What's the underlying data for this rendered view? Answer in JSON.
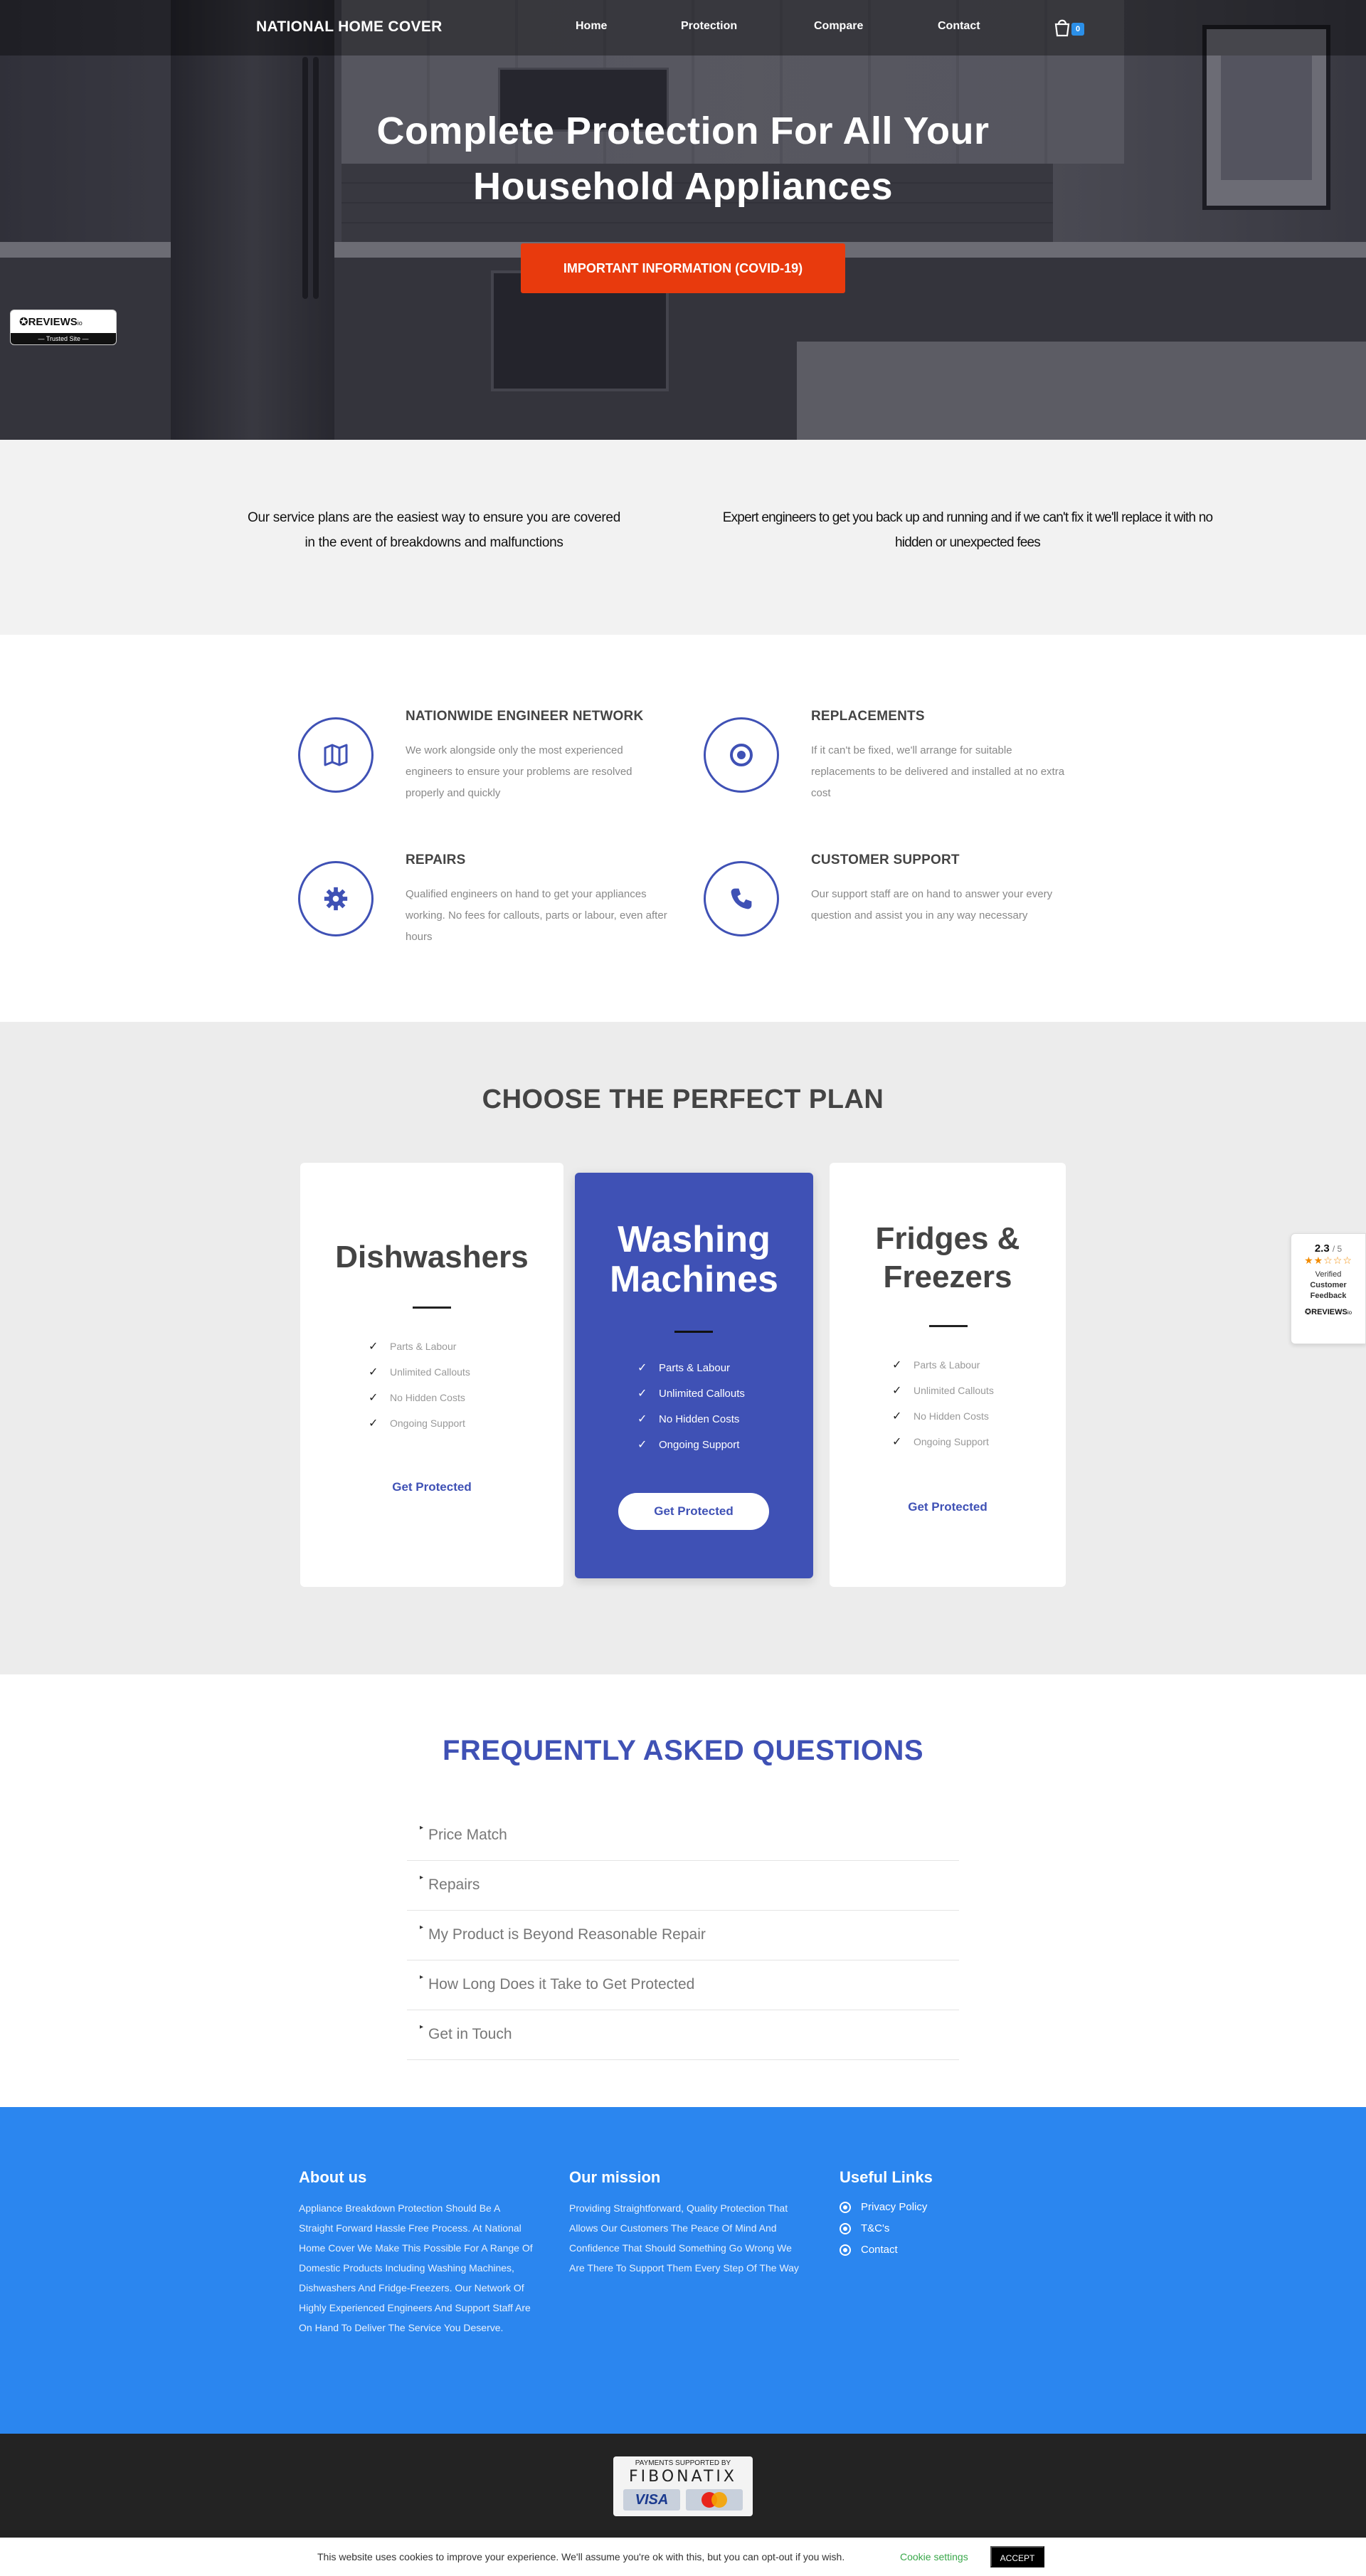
{
  "header": {
    "brand": "NATIONAL HOME COVER",
    "nav": [
      "Home",
      "Protection",
      "Compare",
      "Contact"
    ],
    "cart_count": "0"
  },
  "hero": {
    "title_line1": "Complete Protection For All Your",
    "title_line2": "Household Appliances",
    "button": "IMPORTANT INFORMATION (COVID-19)"
  },
  "reviews_badge": {
    "logo": "REVIEWS",
    "logo_suffix": "io",
    "trusted": "— Trusted Site —"
  },
  "intro": {
    "left_line1": "Our service plans are the easiest way to ensure you are covered",
    "left_line2": "in the event of breakdowns and malfunctions",
    "right_line1": "Expert engineers to get you back up and running and if we can't fix it we'll replace it with no",
    "right_line2": "hidden or unexpected fees"
  },
  "features": [
    {
      "icon": "map-icon",
      "title": "NATIONWIDE ENGINEER NETWORK",
      "desc": "We work alongside only the most experienced engineers to ensure your problems are resolved properly and quickly"
    },
    {
      "icon": "target-icon",
      "title": "REPLACEMENTS",
      "desc": "If it can't be fixed, we'll arrange for suitable replacements to be delivered and installed at no extra cost"
    },
    {
      "icon": "gear-icon",
      "title": "REPAIRS",
      "desc": "Qualified engineers on hand to get your appliances working. No fees for callouts, parts or labour, even after hours"
    },
    {
      "icon": "phone-icon",
      "title": "CUSTOMER SUPPORT",
      "desc": "Our support staff are on hand to answer your every question and assist you in any way necessary"
    }
  ],
  "plans": {
    "title": "CHOOSE THE PERFECT PLAN",
    "cards": [
      {
        "title_line1": "Dishwashers",
        "title_line2": "",
        "features": [
          "Parts & Labour",
          "Unlimited Callouts",
          "No Hidden Costs",
          "Ongoing Support"
        ],
        "cta": "Get Protected"
      },
      {
        "title_line1": "Washing",
        "title_line2": "Machines",
        "features": [
          "Parts & Labour",
          "Unlimited Callouts",
          "No Hidden Costs",
          "Ongoing Support"
        ],
        "cta": "Get Protected"
      },
      {
        "title_line1": "Fridges &",
        "title_line2": "Freezers",
        "features": [
          "Parts & Labour",
          "Unlimited Callouts",
          "No Hidden Costs",
          "Ongoing Support"
        ],
        "cta": "Get Protected"
      }
    ]
  },
  "feedback_widget": {
    "score": "2.3",
    "out_of": "/ 5",
    "stars": "★★☆☆☆",
    "line1": "Verified",
    "line2": "Customer",
    "line3": "Feedback",
    "logo": "REVIEWS",
    "logo_suffix": "io"
  },
  "faq": {
    "title": "FREQUENTLY ASKED QUESTIONS",
    "items": [
      "Price Match",
      "Repairs",
      "My Product is Beyond Reasonable Repair",
      "How Long Does it Take to Get Protected",
      "Get in Touch"
    ]
  },
  "footer": {
    "about_heading": "About us",
    "about_text": "Appliance Breakdown Protection Should Be A Straight Forward Hassle Free Process. At National Home Cover We Make This Possible For A Range Of Domestic Products Including Washing Machines, Dishwashers And Fridge-Freezers. Our Network Of Highly Experienced Engineers And Support Staff Are On Hand To Deliver The Service You Deserve.",
    "mission_heading": "Our mission",
    "mission_text": "Providing Straightforward, Quality Protection That Allows Our Customers The Peace Of Mind And Confidence That Should Something Go Wrong We Are There To Support Them Every Step Of The Way",
    "links_heading": "Useful Links",
    "links": [
      "Privacy Policy",
      "T&C's",
      "Contact"
    ]
  },
  "payments": {
    "label": "PAYMENTS SUPPORTED BY",
    "brand": "FIBONATIX",
    "visa": "VISA"
  },
  "cookie": {
    "text": "This website uses cookies to improve your experience. We'll assume you're ok with this, but you can opt-out if you wish.",
    "settings": "Cookie settings",
    "accept": "ACCEPT"
  },
  "colors": {
    "accent_blue": "#3f51b5",
    "footer_blue": "#2b86ef",
    "hero_button": "#e83a0d"
  }
}
